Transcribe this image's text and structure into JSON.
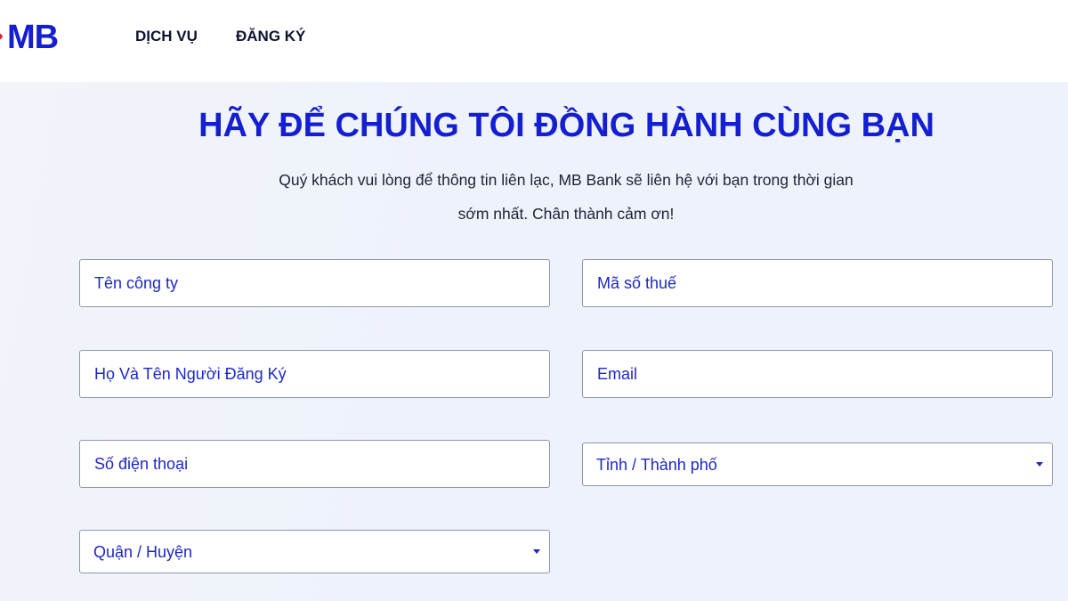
{
  "header": {
    "logo_text": "MB",
    "nav": [
      {
        "label": "DỊCH VỤ"
      },
      {
        "label": "ĐĂNG KÝ"
      }
    ]
  },
  "hero": {
    "title": "HÃY ĐỂ CHÚNG TÔI ĐỒNG HÀNH CÙNG BẠN",
    "subtitle_line1": "Quý khách vui lòng để thông tin liên lạc, MB Bank sẽ liên hệ với bạn trong thời gian",
    "subtitle_line2": "sớm nhất. Chân thành cảm ơn!"
  },
  "form": {
    "company_name": {
      "value": "",
      "placeholder": "Tên công ty"
    },
    "tax_code": {
      "value": "",
      "placeholder": "Mã số thuế"
    },
    "registrant_name": {
      "value": "",
      "placeholder": "Họ Và Tên Người Đăng Ký"
    },
    "email": {
      "value": "",
      "placeholder": "Email"
    },
    "phone": {
      "value": "",
      "placeholder": "Số điện thoại"
    },
    "province": {
      "selected": "Tỉnh / Thành phố"
    },
    "district": {
      "selected": "Quận / Huyện"
    }
  },
  "colors": {
    "brand_blue": "#141ed2",
    "logo_accent_red": "#e01c2c",
    "field_border": "#8e96ad",
    "text_dark": "#1d2237"
  },
  "icons": {
    "select_caret": "chevron-down-icon"
  }
}
